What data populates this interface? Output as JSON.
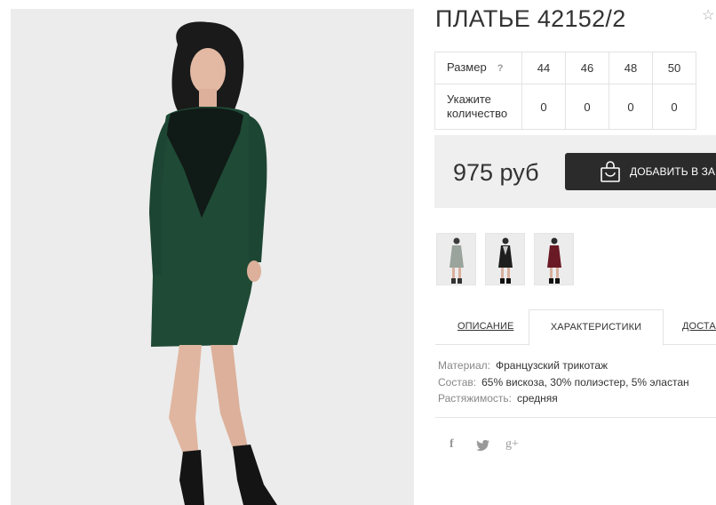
{
  "product": {
    "title": "ПЛАТЬЕ 42152/2",
    "favorite_icon": "star-icon"
  },
  "size_table": {
    "size_label": "Размер",
    "help_label": "?",
    "sizes": [
      "44",
      "46",
      "48",
      "50"
    ],
    "qty_label": "Укажите количество",
    "quantities": [
      "0",
      "0",
      "0",
      "0"
    ]
  },
  "price": {
    "value": "975 руб"
  },
  "cart_button": {
    "label": "ДОБАВИТЬ В ЗАКАЗ",
    "icon": "shopping-bag-icon"
  },
  "thumbnails": [
    {
      "icon": "dress-gray-thumbnail",
      "color": "#9aa39c"
    },
    {
      "icon": "dress-black-thumbnail",
      "color": "#1e1e1e"
    },
    {
      "icon": "dress-burgundy-thumbnail",
      "color": "#6a1a25"
    }
  ],
  "tabs": {
    "description": "ОПИСАНИЕ",
    "characteristics": "ХАРАКТЕРИСТИКИ",
    "delivery": "ДОСТАВКА"
  },
  "characteristics": [
    {
      "key": "Материал:",
      "value": "Французский трикотаж"
    },
    {
      "key": "Состав:",
      "value": "65% вискоза, 30% полиэстер, 5% эластан"
    },
    {
      "key": "Растяжимость:",
      "value": "средняя"
    }
  ],
  "social": {
    "facebook": "f",
    "twitter": "twitter-icon",
    "google_plus": "g+"
  },
  "colors": {
    "dress_main": "#1f4a36",
    "button_bg": "#2b2b2b",
    "price_bg": "#efefef"
  }
}
